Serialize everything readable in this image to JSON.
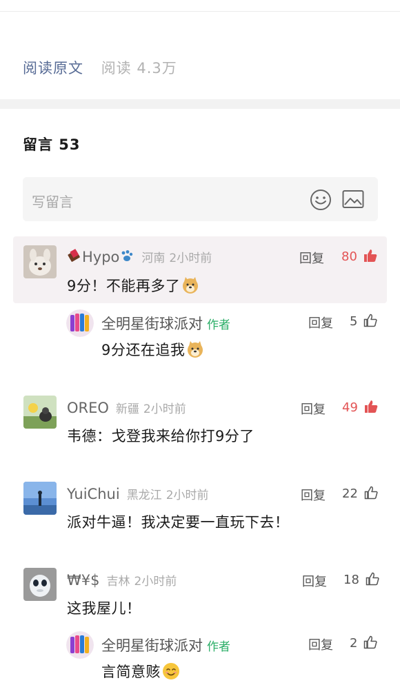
{
  "article": {
    "read_original": "阅读原文",
    "read_count": "阅读 4.3万"
  },
  "comments_section": {
    "heading": "留言 53",
    "write_placeholder": "写留言"
  },
  "comments": [
    {
      "nickname": "Hypo",
      "location": "河南",
      "time": "2小时前",
      "reply_label": "回复",
      "likes": "80",
      "liked": true,
      "text": "9分！不能再多了"
    },
    {
      "nickname": "全明星街球派对",
      "author_tag": "作者",
      "reply_label": "回复",
      "likes": "5",
      "text": "9分还在追我"
    },
    {
      "nickname": "OREO",
      "location": "新疆",
      "time": "2小时前",
      "reply_label": "回复",
      "likes": "49",
      "liked": true,
      "text": "韦德：戈登我来给你打9分了"
    },
    {
      "nickname": "YuiChui",
      "location": "黑龙江",
      "time": "2小时前",
      "reply_label": "回复",
      "likes": "22",
      "text": "派对牛逼！我决定要一直玩下去！"
    },
    {
      "nickname": "₩¥$",
      "location": "吉林",
      "time": "2小时前",
      "reply_label": "回复",
      "likes": "18",
      "text": "这我屋儿！"
    },
    {
      "nickname": "全明星街球派对",
      "author_tag": "作者",
      "reply_label": "回复",
      "likes": "2",
      "text": "言简意赅"
    }
  ],
  "colors": {
    "link": "#576b95",
    "hot_like": "#e35455",
    "author_tag": "#2aae67",
    "highlight_bg": "#f5f1f3"
  }
}
